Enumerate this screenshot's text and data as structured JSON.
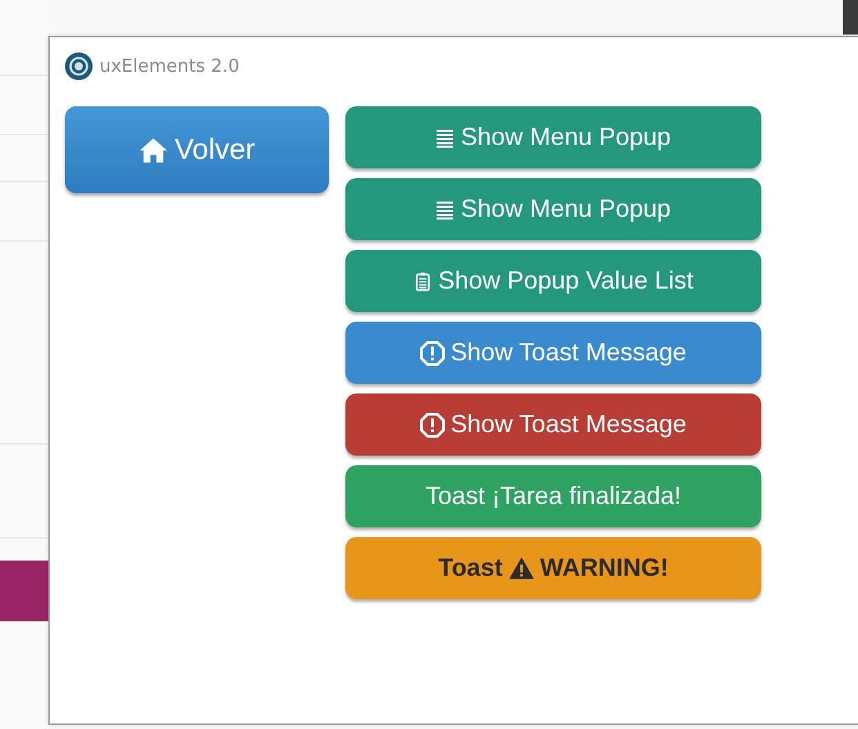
{
  "window": {
    "title": "uxElements 2.0"
  },
  "back_button": {
    "label": "Volver"
  },
  "buttons": [
    {
      "label": "Show Menu Popup",
      "kind": "menu",
      "color": "#23987c"
    },
    {
      "label": "Show Menu Popup",
      "kind": "menu",
      "color": "#23987c"
    },
    {
      "label": "Show Popup Value List",
      "kind": "clipboard",
      "color": "#23987c"
    },
    {
      "label": "Show Toast Message",
      "kind": "alert",
      "color": "#3a8bcd"
    },
    {
      "label": "Show Toast Message",
      "kind": "alert",
      "color": "#b83d35"
    },
    {
      "label": "Toast ¡Tarea finalizada!",
      "kind": "plain",
      "color": "#2ea361"
    },
    {
      "label": "Toast",
      "kind": "warning",
      "label_after": "WARNING!",
      "color": "#e8961a"
    }
  ]
}
